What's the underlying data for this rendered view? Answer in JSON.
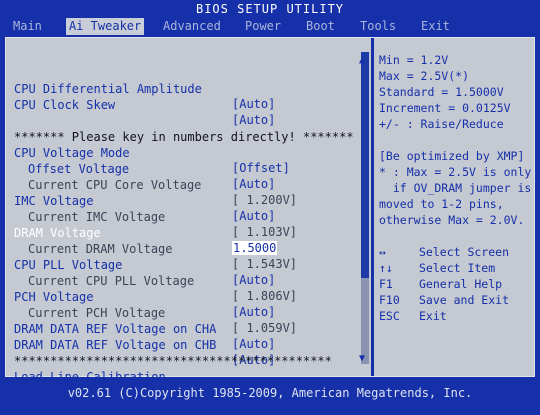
{
  "title": "BIOS SETUP UTILITY",
  "menu": [
    "Main",
    "Ai Tweaker",
    "Advanced",
    "Power",
    "Boot",
    "Tools",
    "Exit"
  ],
  "active_menu": "Ai Tweaker",
  "settings": [
    {
      "label": "CPU Differential Amplitude",
      "value": "[Auto]"
    },
    {
      "label": "CPU Clock Skew",
      "value": "[Auto]"
    },
    {
      "label": "******* Please key in numbers directly! *******",
      "value": ""
    },
    {
      "label": "CPU Voltage Mode",
      "value": "[Offset]"
    },
    {
      "label": "Offset Voltage",
      "value": "[Auto]"
    },
    {
      "label": "Current CPU Core Voltage",
      "value": "[ 1.200V]"
    },
    {
      "label": "IMC Voltage",
      "value": "[Auto]"
    },
    {
      "label": "Current IMC Voltage",
      "value": "[ 1.103V]"
    },
    {
      "label": "DRAM Voltage",
      "value": "1.5000"
    },
    {
      "label": "Current DRAM Voltage",
      "value": "[ 1.543V]"
    },
    {
      "label": "CPU PLL Voltage",
      "value": "[Auto]"
    },
    {
      "label": "Current CPU PLL Voltage",
      "value": "[ 1.806V]"
    },
    {
      "label": "PCH Voltage",
      "value": "[Auto]"
    },
    {
      "label": "Current PCH Voltage",
      "value": "[ 1.059V]"
    },
    {
      "label": "DRAM DATA REF Voltage on CHA",
      "value": "[Auto]"
    },
    {
      "label": "DRAM DATA REF Voltage on CHB",
      "value": "[Auto]"
    },
    {
      "label": "********************************************",
      "value": ""
    },
    {
      "label": "Load-Line Calibration",
      "value": "[Auto]"
    }
  ],
  "help": {
    "range": [
      "Min = 1.2V",
      "Max = 2.5V(*)",
      "Standard = 1.5000V",
      "Increment = 0.0125V",
      "+/- : Raise/Reduce"
    ],
    "notes": [
      "[Be optimized by XMP]",
      "* : Max = 2.5V is only",
      "  if OV_DRAM jumper is",
      "moved to 1-2 pins,",
      "otherwise Max = 2.0V."
    ]
  },
  "keys": [
    {
      "key": "↔",
      "action": "Select Screen"
    },
    {
      "key": "↑↓",
      "action": "Select Item"
    },
    {
      "key": "F1",
      "action": "General Help"
    },
    {
      "key": "F10",
      "action": "Save and Exit"
    },
    {
      "key": "ESC",
      "action": "Exit"
    }
  ],
  "footer": "v02.61 (C)Copyright 1985-2009, American Megatrends, Inc."
}
